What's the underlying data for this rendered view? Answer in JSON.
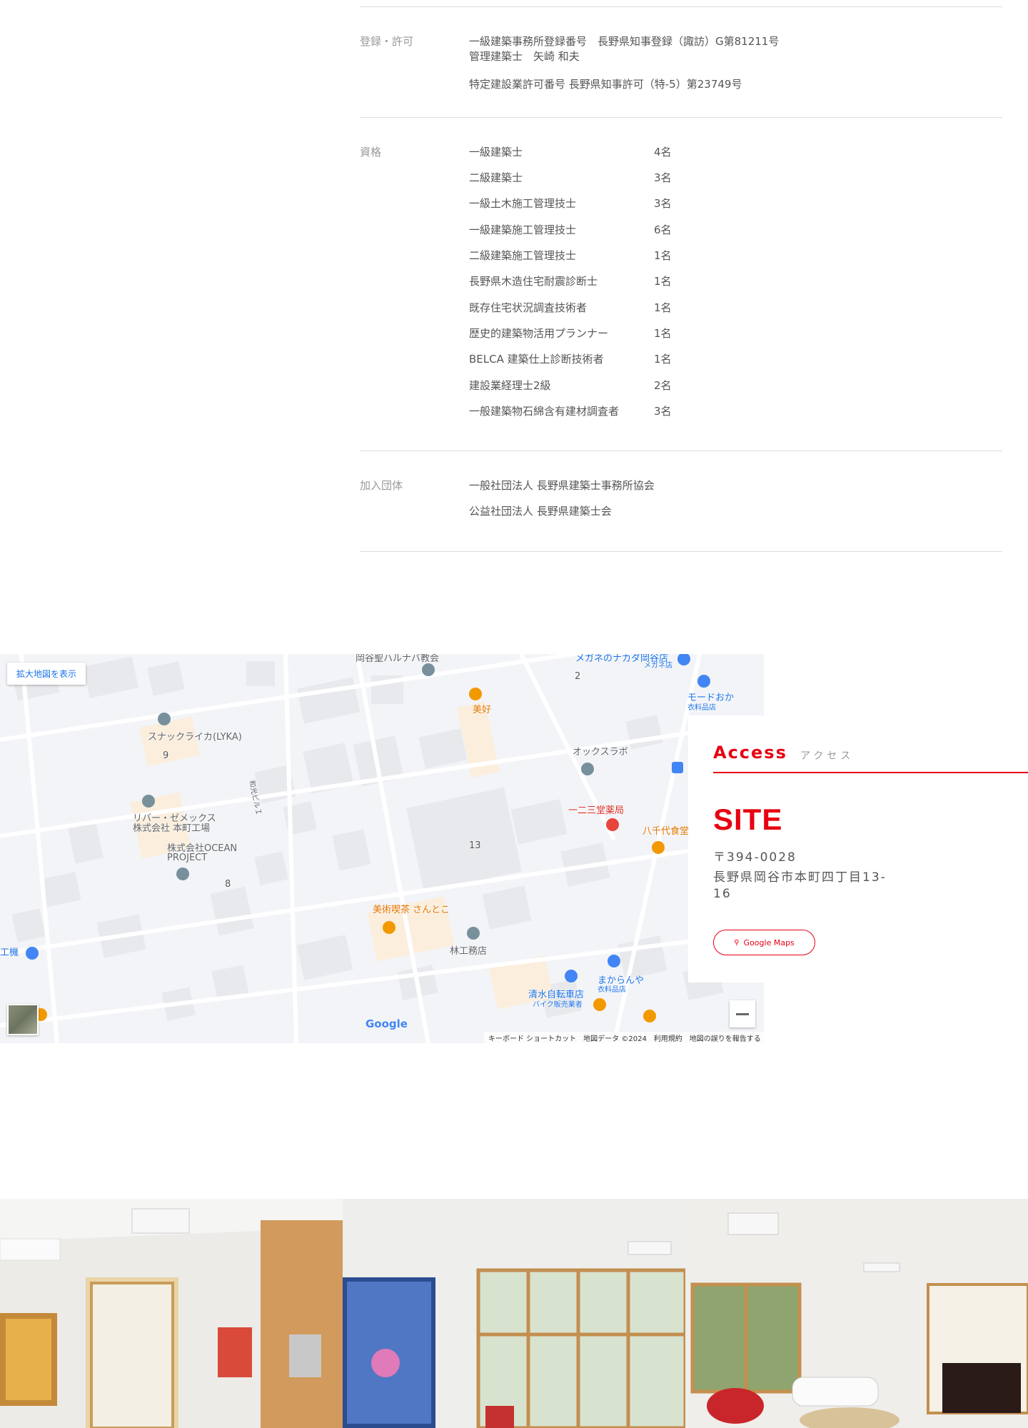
{
  "info": {
    "registration": {
      "label": "登録・許可",
      "line1": "一級建築事務所登録番号　長野県知事登録（諏訪）G第81211号",
      "line2": "管理建築士　矢崎 和夫",
      "line3": "特定建設業許可番号 長野県知事許可（特-5）第23749号"
    },
    "qualifications": {
      "label": "資格",
      "items": [
        {
          "name": "一級建築士",
          "count": "4名"
        },
        {
          "name": "二級建築士",
          "count": "3名"
        },
        {
          "name": "一級土木施工管理技士",
          "count": "3名"
        },
        {
          "name": "一級建築施工管理技士",
          "count": "6名"
        },
        {
          "name": "二級建築施工管理技士",
          "count": "1名"
        },
        {
          "name": "長野県木造住宅耐震診断士",
          "count": "1名"
        },
        {
          "name": "既存住宅状況調査技術者",
          "count": "1名"
        },
        {
          "name": "歴史的建築物活用プランナー",
          "count": "1名"
        },
        {
          "name": "BELCA 建築仕上診断技術者",
          "count": "1名"
        },
        {
          "name": "建設業経理士2級",
          "count": "2名"
        },
        {
          "name": "一般建築物石綿含有建材調査者",
          "count": "3名"
        }
      ]
    },
    "associations": {
      "label": "加入団体",
      "items": [
        "一般社団法人 長野県建築士事務所協会",
        "公益社団法人 長野県建築士会"
      ]
    }
  },
  "map": {
    "expand_button": "拡大地図を表示",
    "labels": {
      "church": "岡谷聖ハルナバ教会",
      "megane": "メガネのナカダ岡谷店",
      "megane_sub": "メガネ店",
      "mode": "モードおか",
      "mode_sub": "衣料品店",
      "bikou": "美好",
      "snack": "スナックライカ(LYKA)",
      "oxlab": "オックスラボ",
      "pharmacy": "一二三堂薬局",
      "yachiyo": "八千代食堂",
      "river1": "リバー・ゼメックス",
      "river2": "株式会社 本町工場",
      "ocean1": "株式会社OCEAN",
      "ocean2": "PROJECT",
      "wako": "和光ビルＩ",
      "cafe": "美術喫茶 さんとこ",
      "hayashi": "林工務店",
      "shimizu": "清水自転車店",
      "shimizu_sub": "バイク販売業者",
      "makaranya": "まからんや",
      "makaranya_sub": "衣料品店",
      "kouki": "工機",
      "num2": "2",
      "num9": "9",
      "num13": "13",
      "num8": "8"
    },
    "google": "Google",
    "footer": "キーボード ショートカット　地図データ ©2024　利用規約　地図の誤りを報告する"
  },
  "access": {
    "title": "Access",
    "subtitle": "アクセス",
    "site": "SITE",
    "postal": "〒394-0028",
    "address1": "長野県岡谷市本町四丁目13-",
    "address2": "16",
    "button": "Google Maps"
  },
  "colors": {
    "accent": "#e60012",
    "divider": "#dcdcdc"
  }
}
